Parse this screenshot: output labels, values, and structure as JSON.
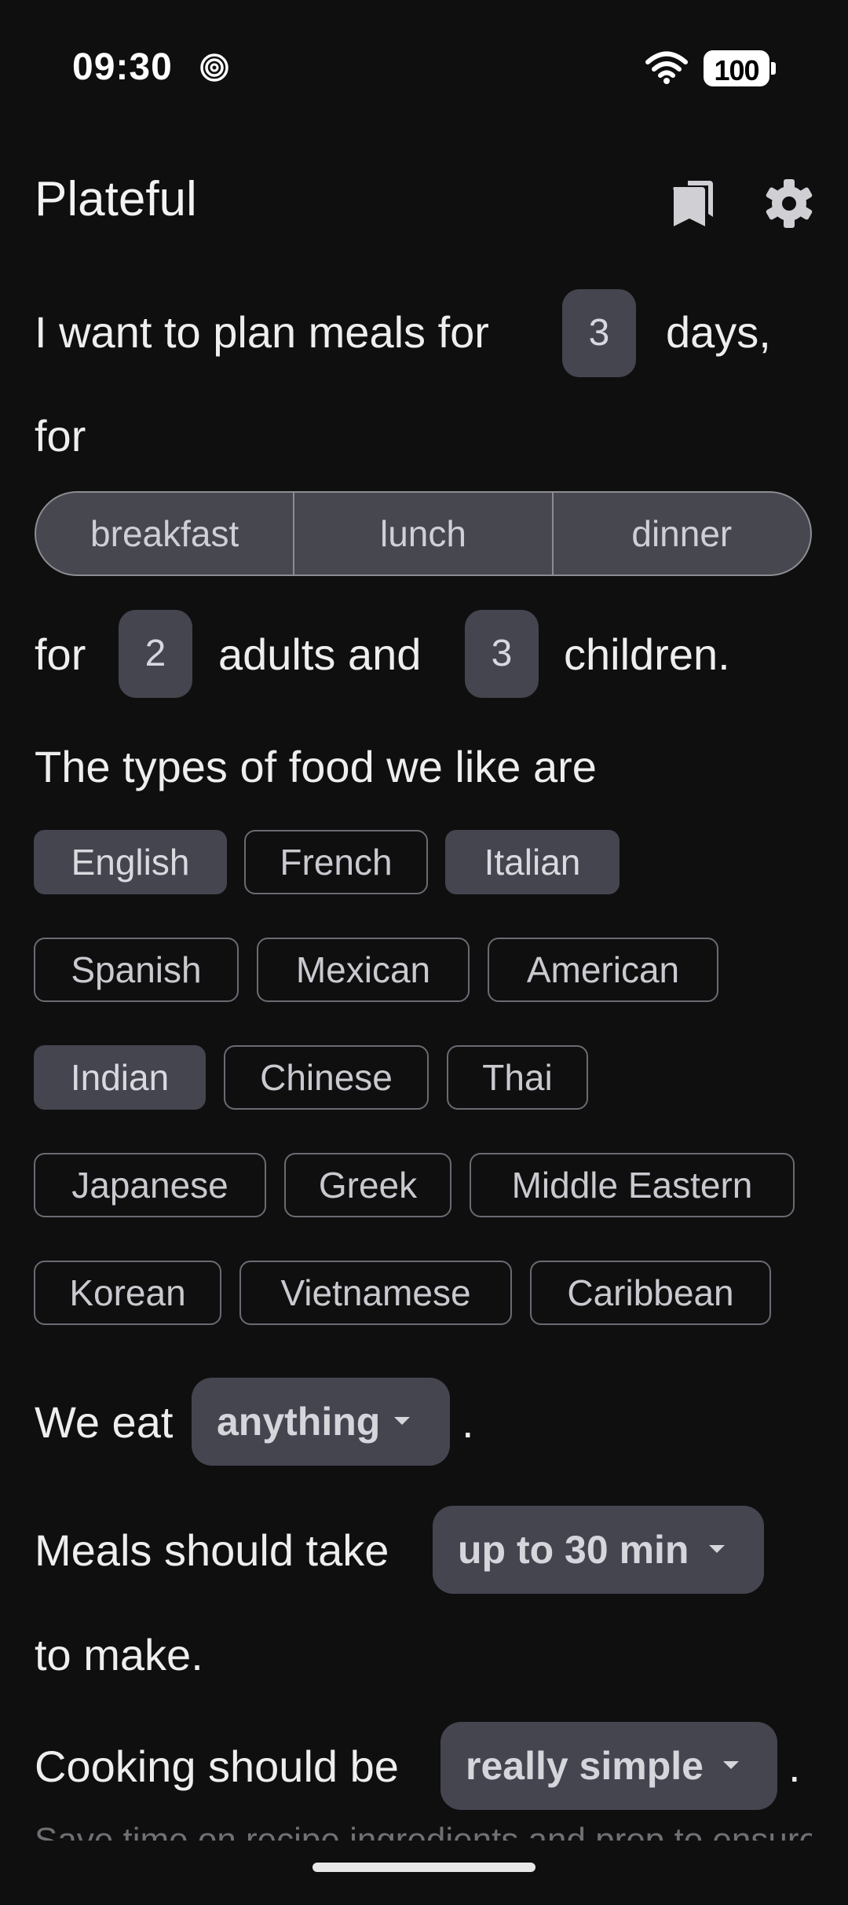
{
  "status_bar": {
    "time": "09:30",
    "battery": "100"
  },
  "app": {
    "title": "Plateful"
  },
  "plan": {
    "intro": "I want to plan meals for",
    "days": "3",
    "days_suffix": "days,",
    "for_label": "for",
    "meals": [
      "breakfast",
      "lunch",
      "dinner"
    ],
    "for2": "for",
    "adults": "2",
    "adults_label": "adults and",
    "children": "3",
    "children_label": "children."
  },
  "cuisines": {
    "label": "The types of food we like are",
    "options": [
      {
        "label": "English",
        "selected": true
      },
      {
        "label": "French",
        "selected": false
      },
      {
        "label": "Italian",
        "selected": true
      },
      {
        "label": "Spanish",
        "selected": false
      },
      {
        "label": "Mexican",
        "selected": false
      },
      {
        "label": "American",
        "selected": false
      },
      {
        "label": "Indian",
        "selected": true
      },
      {
        "label": "Chinese",
        "selected": false
      },
      {
        "label": "Thai",
        "selected": false
      },
      {
        "label": "Japanese",
        "selected": false
      },
      {
        "label": "Greek",
        "selected": false
      },
      {
        "label": "Middle Eastern",
        "selected": false
      },
      {
        "label": "Korean",
        "selected": false
      },
      {
        "label": "Vietnamese",
        "selected": false
      },
      {
        "label": "Caribbean",
        "selected": false
      }
    ]
  },
  "diet": {
    "prefix": "We eat",
    "value": "anything",
    "suffix": "."
  },
  "time_pref": {
    "prefix": "Meals should take",
    "value": "up to 30 min",
    "suffix": "to make."
  },
  "cooking": {
    "prefix": "Cooking should be",
    "value": "really simple",
    "suffix": "."
  },
  "cut_off_text": "Save time on recipe ingredients and prep to ensure simple"
}
